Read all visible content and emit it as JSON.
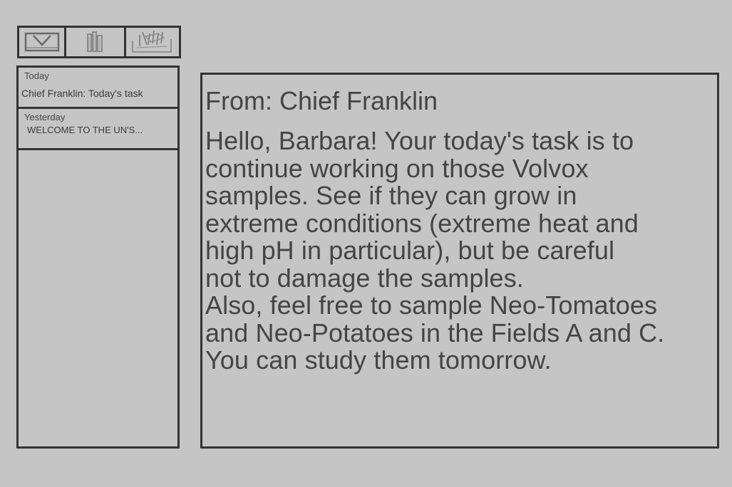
{
  "toolbar": {
    "items": [
      {
        "icon": "envelope-icon",
        "label": ""
      },
      {
        "icon": "files-icon",
        "label": ""
      },
      {
        "icon": "pen-tray-icon",
        "label": ""
      }
    ]
  },
  "message_list": {
    "items": [
      {
        "date": "Today",
        "subject": "Chief Franklin: Today's task"
      },
      {
        "date": "Yesterday",
        "subject": "WELCOME TO THE  UN'S..."
      }
    ]
  },
  "reader": {
    "from": "From: Chief Franklin",
    "body": "Hello, Barbara! Your today's task is to\ncontinue working on those Volvox\nsamples. See if they can grow in\nextreme conditions (extreme heat and\nhigh pH in particular), but be careful\nnot to damage the samples.\nAlso, feel free to sample Neo-Tomatoes\nand Neo-Potatoes in the Fields A and C.\nYou can study them tomorrow."
  },
  "colors": {
    "background": "#c5c5c5",
    "border": "#333333",
    "text": "#444444"
  }
}
